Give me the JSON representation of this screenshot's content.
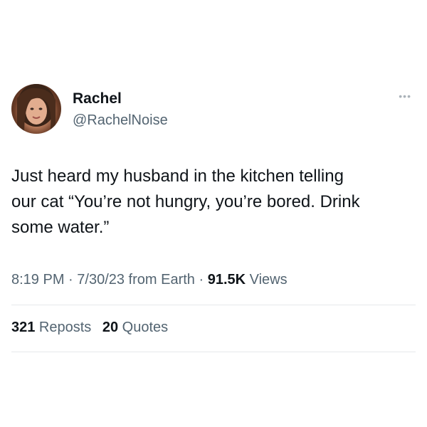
{
  "tweet": {
    "author": {
      "display_name": "Rachel",
      "handle": "@RachelNoise",
      "avatar_icon": "profile-photo"
    },
    "more_icon": "more-dots-icon",
    "text": "Just heard my husband in the kitchen telling\nour cat “You’re not hungry, you’re bored. Drink\nsome water.”",
    "meta": {
      "time": "8:19 PM",
      "separator_1": " · ",
      "date": "7/30/23",
      "source": " from Earth",
      "separator_2": " · ",
      "views_count": "91.5K",
      "views_label": " Views"
    },
    "stats": {
      "reposts_count": "321",
      "reposts_label": " Reposts",
      "quotes_count": "20",
      "quotes_label": " Quotes"
    }
  },
  "colors": {
    "text_primary": "#0f1419",
    "text_secondary": "#536471",
    "divider": "#e6e9eb"
  }
}
